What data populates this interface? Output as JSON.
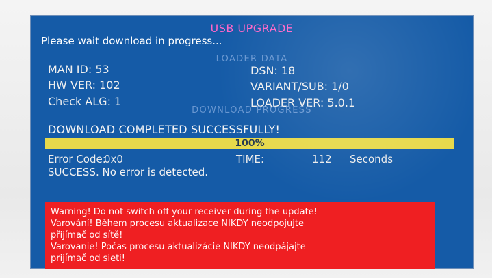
{
  "screen": {
    "title": "USB UPGRADE",
    "status": "Please wait download in progress...",
    "sections": {
      "loader_data": "LOADER DATA",
      "download_progress": "DOWNLOAD PROGRESS"
    }
  },
  "loader_data": {
    "man_id": "MAN ID: 53",
    "hw_ver": "HW VER: 102",
    "check_alg": "Check ALG: 1",
    "dsn": "DSN: 18",
    "variant_sub": "VARIANT/SUB: 1/0",
    "loader_ver": "LOADER VER: 5.0.1"
  },
  "download": {
    "message": "DOWNLOAD COMPLETED SUCCESSFULLY!",
    "progress_percent": "100%",
    "progress_value": 1.0,
    "error_code_label": "Error Code:",
    "error_code_value": "0x0",
    "time_label": "TIME:",
    "time_value": "112",
    "time_unit": "Seconds",
    "success_message": "SUCCESS. No error is detected."
  },
  "warning": {
    "line1": "Warning! Do not switch off your receiver during the update!",
    "line2": "Varování! Během procesu aktualizace NIKDY neodpojujte",
    "line3": "přijímač od sítě!",
    "line4": "Varovanie! Počas procesu aktualizácie NIKDY neodpájajte",
    "line5": "prijímač od sieti!"
  },
  "colors": {
    "screen_bg": "#155ba7",
    "title_pink": "#ff66c8",
    "progress_yellow": "#e7d94b",
    "warning_red": "#ef1f22"
  }
}
